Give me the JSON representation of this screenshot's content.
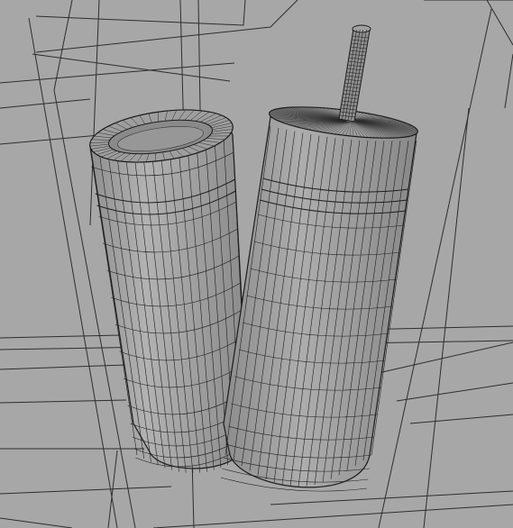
{
  "scene": {
    "description_free": true,
    "colors": {
      "background": "#a7a7a7",
      "scene_lines": "#2b2b2b",
      "mesh_lines": "#1a1a1a",
      "cup_fill_light": "#a8a8a8",
      "cup_fill_dark": "#8e8e8e",
      "lid_fill": "#9b9b9b"
    },
    "objects": [
      {
        "name": "short-cup",
        "type": "wireframe-mesh"
      },
      {
        "name": "tall-tumbler-with-straw",
        "type": "wireframe-mesh"
      }
    ]
  }
}
